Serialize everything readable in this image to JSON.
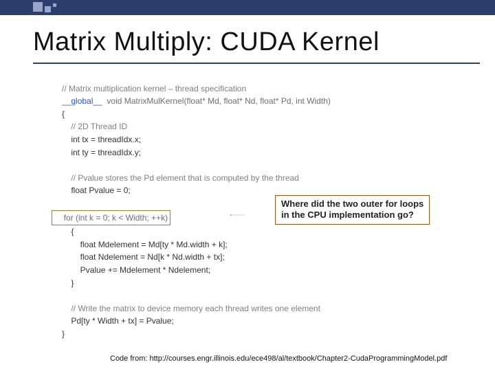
{
  "title": "Matrix Multiply:  CUDA Kernel",
  "code": {
    "c01": "// Matrix multiplication kernel – thread specification",
    "c02a": "__global__",
    "c02b": "  void MatrixMulKernel(float* Md, float* Nd, float* Pd, int Width)",
    "c03": "{",
    "c04": "    // 2D Thread ID",
    "c05": "    int tx = threadIdx.x;",
    "c06": "    int ty = threadIdx.y;",
    "c07": "",
    "c08": "    // Pvalue stores the Pd element that is computed by the thread",
    "c09": "    float Pvalue = 0;",
    "c10": "",
    "c11": "    for (int k = 0; k < Width; ++k)",
    "c12": "    {",
    "c13": "        float Mdelement = Md[ty * Md.width + k];",
    "c14": "        float Ndelement = Nd[k * Nd.width + tx];",
    "c15": "        Pvalue += Mdelement * Ndelement;",
    "c16": "    }",
    "c17": "",
    "c18": "    // Write the matrix to device memory each thread writes one element",
    "c19": "    Pd[ty * Width + tx] = Pvalue;",
    "c20": "}"
  },
  "callout": "Where did the two outer for loops\nin the CPU implementation go?",
  "citation": "Code from:  http://courses.engr.illinois.edu/ece498/al/textbook/Chapter2-CudaProgrammingModel.pdf"
}
